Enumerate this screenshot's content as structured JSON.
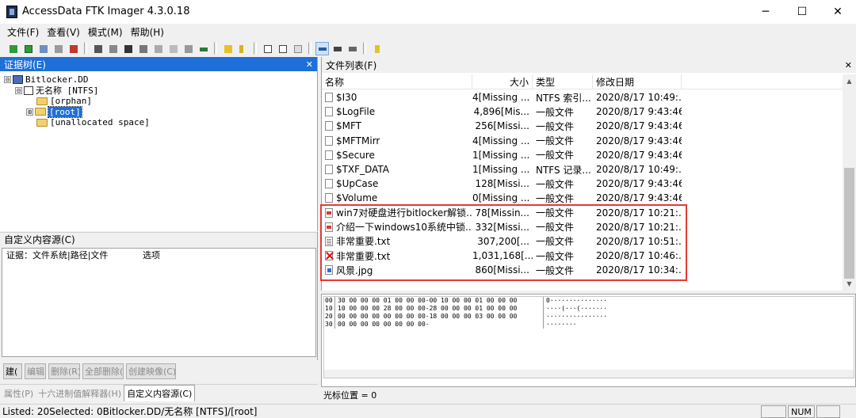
{
  "window": {
    "title": "AccessData FTK Imager 4.3.0.18",
    "minimize_glyph": "─",
    "maximize_glyph": "☐",
    "close_glyph": "✕"
  },
  "menu": [
    "文件(F)",
    "查看(V)",
    "模式(M)",
    "帮助(H)"
  ],
  "toolbar": {
    "icons": [
      "add-evidence-icon",
      "add-all-evidence-icon",
      "image-mounting-icon",
      "remove-evidence-icon",
      "remove-all-evidence-icon",
      "create-disk-image-icon",
      "export-disk-image-icon",
      "export-logical-image-icon",
      "add-to-custom-content-icon",
      "create-custom-image-icon",
      "decrypt-icon",
      "verify-drive-icon",
      "capture-memory-icon",
      "obtain-protected-files-icon",
      "detect-efs-icon",
      "export-files-icon",
      "export-hash-list-icon",
      "export-directory-listing-icon",
      "auto-view-icon",
      "text-view-icon",
      "hex-view-icon",
      "help-icon"
    ],
    "active_icon": "hex-view-icon"
  },
  "evidence_tree": {
    "title": "证据树(E)",
    "close": "✕",
    "nodes": [
      {
        "label": "Bitlocker.DD",
        "expander": "⊟",
        "icon": "drive-icon"
      },
      {
        "label": "无名称 [NTFS]",
        "expander": "⊟",
        "icon": "partition-icon"
      },
      {
        "label": "[orphan]",
        "expander": "",
        "icon": "folder-icon"
      },
      {
        "label": "[root]",
        "expander": "⊞",
        "icon": "folder-icon",
        "selected": true
      },
      {
        "label": "[unallocated space]",
        "expander": "",
        "icon": "folder-icon"
      }
    ]
  },
  "custom_content": {
    "title": "自定义内容源(C)",
    "columns": [
      "证据：文件系统|路径|文件",
      "选项"
    ],
    "buttons": [
      "建(",
      "编辑(E)",
      "删除(R)",
      "全部删除(A",
      "创建映像(C)"
    ],
    "tabs": [
      "属性(P)",
      "十六进制值解释器(H)",
      "自定义内容源(C)"
    ],
    "active_tab": "自定义内容源(C)"
  },
  "file_list": {
    "title": "文件列表(F)",
    "close": "✕",
    "columns": {
      "name": "名称",
      "size": "大小",
      "type": "类型",
      "date": "修改日期"
    },
    "rows": [
      {
        "name": "$I30",
        "size": "4[Missing ...",
        "type": "NTFS 索引...",
        "date": "2020/8/17 10:49:...",
        "icon": "file-icon"
      },
      {
        "name": "$LogFile",
        "size": "4,896[Mis...",
        "type": "一般文件",
        "date": "2020/8/17 9:43:46",
        "icon": "file-icon"
      },
      {
        "name": "$MFT",
        "size": "256[Missi...",
        "type": "一般文件",
        "date": "2020/8/17 9:43:46",
        "icon": "file-icon"
      },
      {
        "name": "$MFTMirr",
        "size": "4[Missing ...",
        "type": "一般文件",
        "date": "2020/8/17 9:43:46",
        "icon": "file-icon"
      },
      {
        "name": "$Secure",
        "size": "1[Missing ...",
        "type": "一般文件",
        "date": "2020/8/17 9:43:46",
        "icon": "file-icon"
      },
      {
        "name": "$TXF_DATA",
        "size": "1[Missing ...",
        "type": "NTFS 记录...",
        "date": "2020/8/17 10:49:...",
        "icon": "file-icon"
      },
      {
        "name": "$UpCase",
        "size": "128[Missi...",
        "type": "一般文件",
        "date": "2020/8/17 9:43:46",
        "icon": "file-icon"
      },
      {
        "name": "$Volume",
        "size": "0[Missing ...",
        "type": "一般文件",
        "date": "2020/8/17 9:43:46",
        "icon": "file-icon"
      },
      {
        "name": "win7对硬盘进行bitlocker解锁...",
        "size": "78[Missin...",
        "type": "一般文件",
        "date": "2020/8/17 10:21:...",
        "icon": "pdf-file-icon"
      },
      {
        "name": "介绍一下windows10系统中锁...",
        "size": "332[Missi...",
        "type": "一般文件",
        "date": "2020/8/17 10:21:...",
        "icon": "pdf-file-icon"
      },
      {
        "name": "非常重要.txt",
        "size": "307,200[...",
        "type": "一般文件",
        "date": "2020/8/17 10:51:...",
        "icon": "text-file-icon"
      },
      {
        "name": "非常重要.txt",
        "size": "1,031,168[...",
        "type": "一般文件",
        "date": "2020/8/17 10:46:...",
        "icon": "deleted-file-icon"
      },
      {
        "name": "风景.jpg",
        "size": "860[Missi...",
        "type": "一般文件",
        "date": "2020/8/17 10:34:...",
        "icon": "image-file-icon"
      }
    ]
  },
  "hex_view": {
    "rows": [
      {
        "offset": "00",
        "bytes": "30 00 00 00 01 00 00 00-00 10 00 00 01 00 00 00",
        "ascii": "0···············"
      },
      {
        "offset": "10",
        "bytes": "10 00 00 00 28 00 00 00-28 00 00 00 01 00 00 00",
        "ascii": "····(···(·······"
      },
      {
        "offset": "20",
        "bytes": "00 00 00 00 00 00 00 00-18 00 00 00 03 00 00 00",
        "ascii": "················"
      },
      {
        "offset": "30",
        "bytes": "00 00 00 00 00 00 00 00-",
        "ascii": "········"
      }
    ],
    "cursor_label": "光标位置 = 0"
  },
  "statusbar": {
    "text": "Listed: 20Selected: 0Bitlocker.DD/无名称 [NTFS]/[root]",
    "num": "NUM"
  },
  "colors": {
    "accent": "#1e6fd9",
    "highlight_box": "#e53935"
  }
}
